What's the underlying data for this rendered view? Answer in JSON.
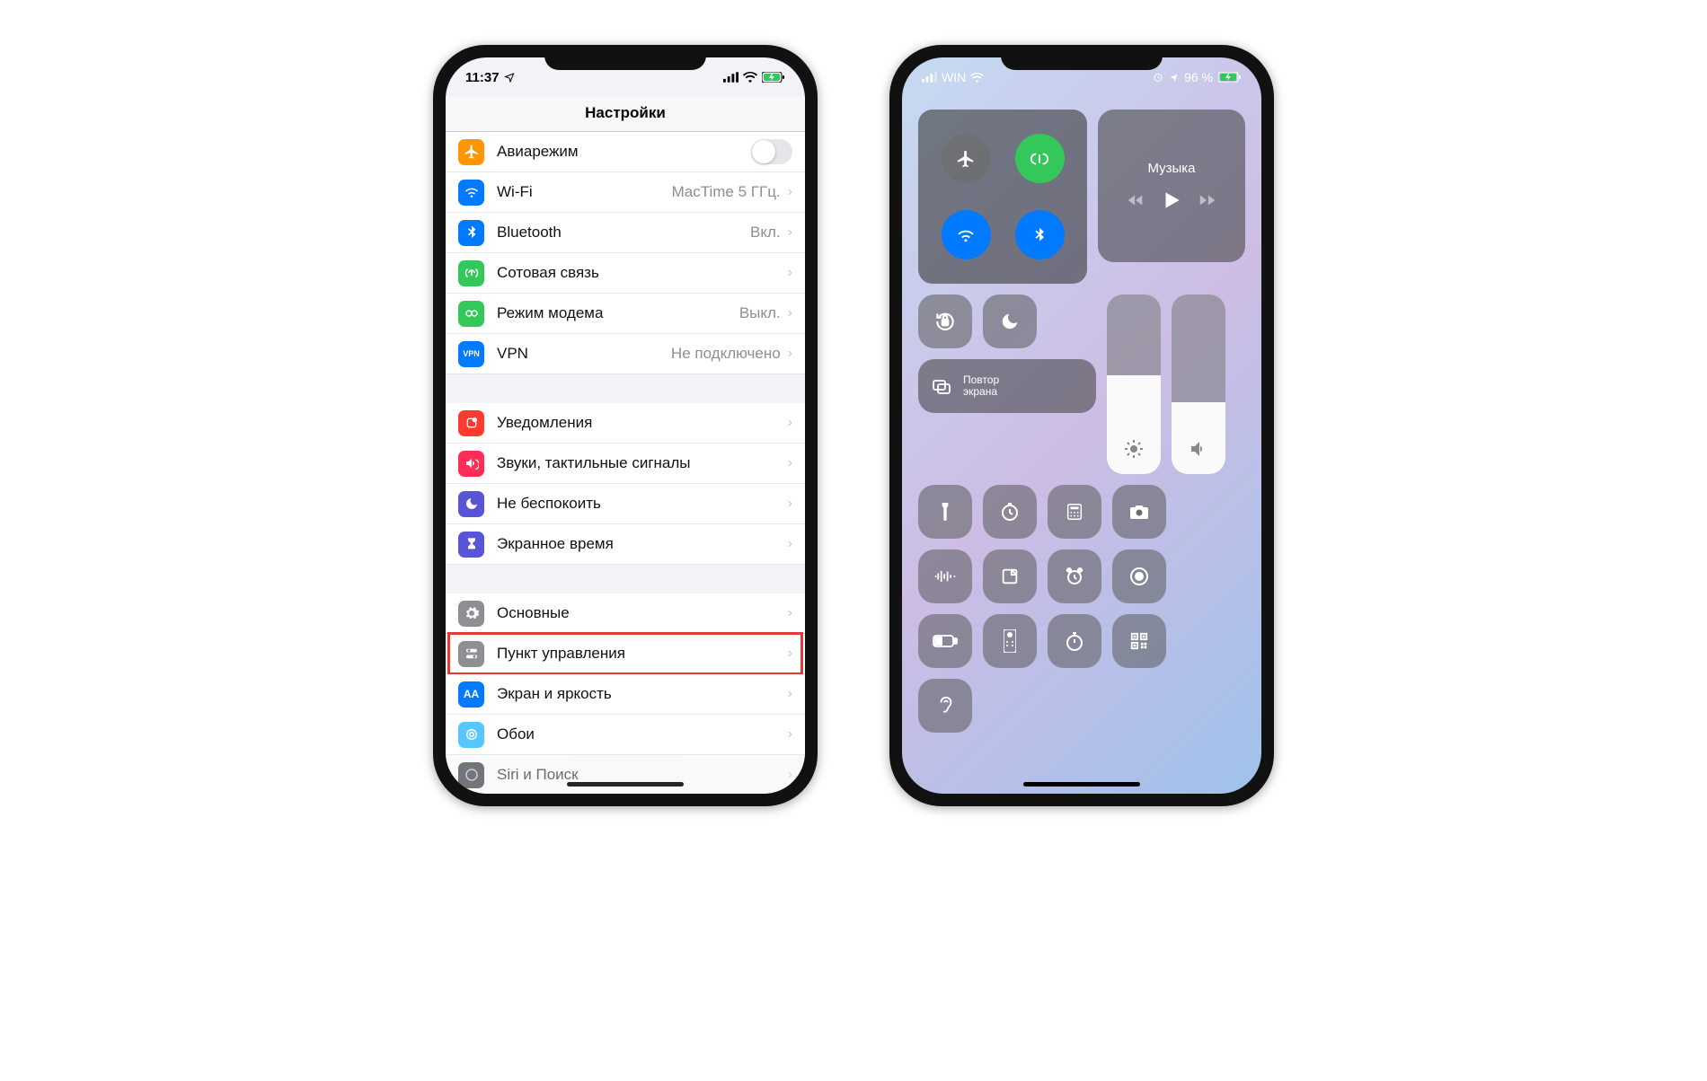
{
  "left": {
    "time": "11:37",
    "title": "Настройки",
    "group1": [
      {
        "key": "airplane",
        "label": "Авиарежим",
        "detail": "",
        "toggle": true,
        "iconBg": "#ff9500"
      },
      {
        "key": "wifi",
        "label": "Wi-Fi",
        "detail": "MacTime 5 ГГц.",
        "iconBg": "#007aff"
      },
      {
        "key": "bluetooth",
        "label": "Bluetooth",
        "detail": "Вкл.",
        "iconBg": "#007aff"
      },
      {
        "key": "cellular",
        "label": "Сотовая связь",
        "detail": "",
        "iconBg": "#34c759"
      },
      {
        "key": "hotspot",
        "label": "Режим модема",
        "detail": "Выкл.",
        "iconBg": "#34c759"
      },
      {
        "key": "vpn",
        "label": "VPN",
        "detail": "Не подключено",
        "iconBg": "#007aff",
        "iconTextVPN": "VPN"
      }
    ],
    "group2": [
      {
        "key": "notifications",
        "label": "Уведомления",
        "iconBg": "#ff3b30"
      },
      {
        "key": "sounds",
        "label": "Звуки, тактильные сигналы",
        "iconBg": "#ff2d55"
      },
      {
        "key": "dnd",
        "label": "Не беспокоить",
        "iconBg": "#5856d6"
      },
      {
        "key": "screentime",
        "label": "Экранное время",
        "iconBg": "#5856d6"
      }
    ],
    "group3": [
      {
        "key": "general",
        "label": "Основные",
        "iconBg": "#8e8e93"
      },
      {
        "key": "control",
        "label": "Пункт управления",
        "iconBg": "#8e8e93",
        "highlighted": true
      },
      {
        "key": "display",
        "label": "Экран и яркость",
        "iconBg": "#007aff",
        "iconTextAA": "AA"
      },
      {
        "key": "wallpaper",
        "label": "Обои",
        "iconBg": "#54c7fc"
      },
      {
        "key": "siri",
        "label": "Siri и Поиск",
        "iconBg": "#222"
      }
    ]
  },
  "right": {
    "carrier": "WIN",
    "battery": "96 %",
    "music_label": "Музыка",
    "mirror_line1": "Повтор",
    "mirror_line2": "экрана",
    "brightness_fill_pct": 55,
    "volume_fill_pct": 40,
    "conn": {
      "airplane_on": false,
      "cellular_on": true,
      "wifi_on": true,
      "bluetooth_on": true
    }
  }
}
